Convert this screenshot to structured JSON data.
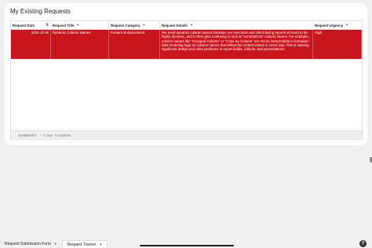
{
  "card": {
    "title": "My Existing Requests"
  },
  "table": {
    "columns": [
      {
        "label": "Request Date",
        "sortable": true
      },
      {
        "label": "Request Title"
      },
      {
        "label": "Request Category"
      },
      {
        "label": "Request Details"
      },
      {
        "label": "Request Urgency"
      }
    ],
    "row_color": "#c8151d",
    "rows": [
      {
        "date": "2024-11-06",
        "title": "Dynamic Column Names",
        "category": "Feature Enhancement",
        "details": "We need dynamic column names because our executive and client-facing reports all need to be highly dynamic, and it often gets confusing to look at \"summarized\" column names. For example, column names like \"Grouped Column\" or \"Color By Column\" are not as interpretable in formulas / data modeling logic as column names that reflect the control values in some way. This is causing significant delays and other problems in report builds, rollouts, and presentations.",
        "urgency": "High"
      }
    ],
    "summary": {
      "label": "SUMMARY",
      "text": "1 row · 5 columns"
    }
  },
  "tabs": [
    {
      "label": "Request Submission Form",
      "active": false
    },
    {
      "label": "Request Tracker",
      "active": true
    }
  ],
  "help": {
    "label": "?"
  },
  "icons": {
    "sort": "sort-icon",
    "dropdown": "chevron-down-icon",
    "summary_toggle": "chevron-up-icon",
    "help": "help-icon"
  }
}
